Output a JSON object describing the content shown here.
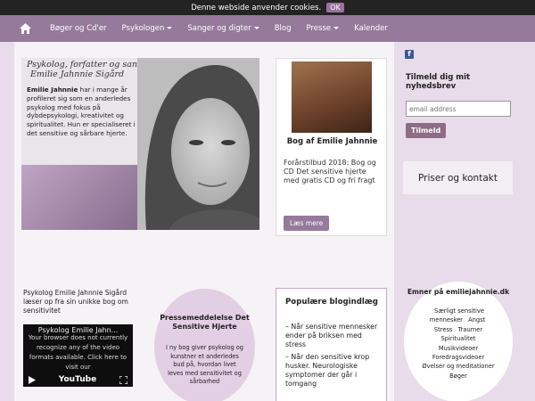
{
  "cookie": {
    "message": "Denne webside anvender cookies.",
    "ok_label": "OK"
  },
  "nav": {
    "items": [
      {
        "label": "Bøger og Cd'er",
        "dropdown": false
      },
      {
        "label": "Psykologen",
        "dropdown": true
      },
      {
        "label": "Sanger og digter",
        "dropdown": true
      },
      {
        "label": "Blog",
        "dropdown": false
      },
      {
        "label": "Presse",
        "dropdown": true
      },
      {
        "label": "Kalender",
        "dropdown": false
      }
    ]
  },
  "hero": {
    "tagline_line1": "Psykolog, forfatter og sanger",
    "tagline_line2": "Emilie Jahnnie Sigård",
    "intro_name": "Emilie Jahnnie",
    "intro_rest": " har i mange år profileret sig som en anderledes psykolog med fokus på dybdepsykologi, kreativitet og spiritualitet. Hun er specialiseret i det sensitive og sårbare hjerte."
  },
  "book": {
    "title": "Bog af Emilie Jahnnie",
    "description": "Forårstilbud 2018: Bog og CD Det sensitive hjerte med gratis CD og fri fragt",
    "button": "Læs mere"
  },
  "video_section": {
    "intro": "Psykolog Emilie Jahnnie Sigård læser op fra sin unikke bog om sensitivitet",
    "title": "Psykolog Emilie Jahn...",
    "message": "Your browser does not currently recognize any of the video formats available. Click here to visit our",
    "logo": "YouTube"
  },
  "press": {
    "title": "Pressemeddelelse Det Sensitive Hjerte",
    "body": "I ny bog giver psykolog og kunstner et anderledes bud på, hvordan livet leves med sensitivitet og sårbarhed"
  },
  "blog": {
    "title": "Populære blogindlæg",
    "entries": [
      "– Når sensitive mennesker ender på briksen med stress",
      "– Når den sensitive krop husker. Neurologiske symptomer der går i tomgang"
    ]
  },
  "newsletter": {
    "title": "Tilmeld dig mit nyhedsbrev",
    "placeholder": "email address",
    "button": "Tilmeld"
  },
  "prices": {
    "label": "Priser og kontakt"
  },
  "topics": {
    "title": "Emner på emiliejahnnie.dk",
    "items": [
      "Særligt sensitive mennesker",
      "Angst",
      "Stress",
      "Traumer",
      "Spiritualitet",
      "Musikvideoer",
      "Foredragsvideoer",
      "Øvelser og meditationer",
      "Bøger"
    ]
  },
  "colors": {
    "nav": "#957a9b",
    "accent": "#8d6c86",
    "background": "#e9dcea"
  }
}
